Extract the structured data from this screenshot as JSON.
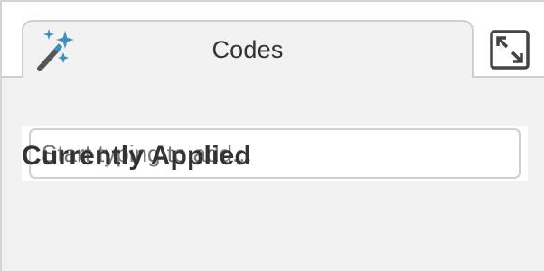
{
  "tabs": [
    {
      "label": "Codes",
      "icon": "magic-wand-icon",
      "active": true
    }
  ],
  "toolbar": {
    "expand_icon": "expand-icon"
  },
  "codes_input": {
    "placeholder": "Start typing to add..."
  },
  "applied_section": {
    "heading": "Currently Applied"
  },
  "colors": {
    "panel_background": "#f2f2f2",
    "border": "#cfcfcf",
    "text": "#333333",
    "sparkle_accent": "#3a8fc0"
  }
}
